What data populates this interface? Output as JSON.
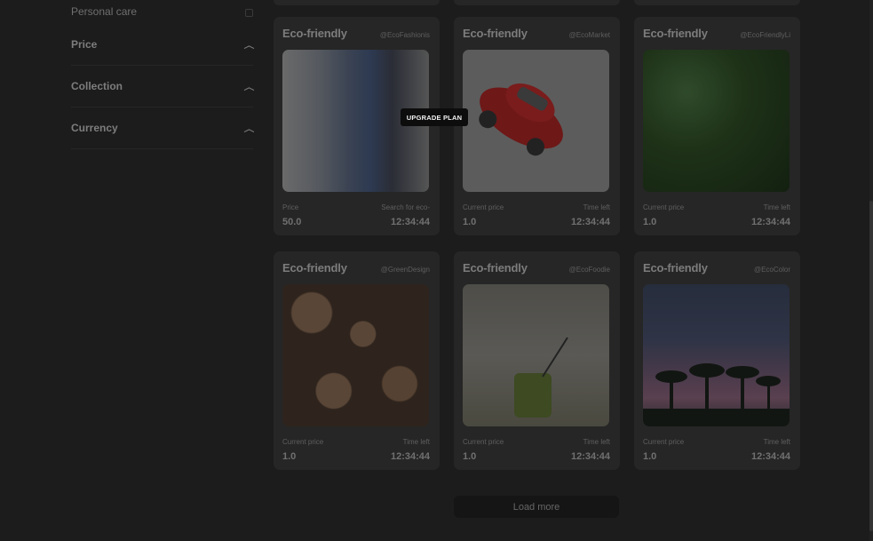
{
  "sidebar": {
    "personal_care": "Personal care",
    "filters": [
      {
        "label": "Price"
      },
      {
        "label": "Collection"
      },
      {
        "label": "Currency"
      }
    ]
  },
  "tooltip": "UPGRADE PLAN",
  "cards": [
    {
      "title": "Eco-friendly",
      "handle": "@EcoFashionis",
      "label_left": "Price",
      "label_right": "Search for eco-",
      "value_left": "50.0",
      "value_right": "12:34:44",
      "image": "stacked-denim-clothes"
    },
    {
      "title": "Eco-friendly",
      "handle": "@EcoMarket",
      "label_left": "Current price",
      "label_right": "Time left",
      "value_left": "1.0",
      "value_right": "12:34:44",
      "image": "red-toy-car"
    },
    {
      "title": "Eco-friendly",
      "handle": "@EcoFriendlyLi",
      "label_left": "Current price",
      "label_right": "Time left",
      "value_left": "1.0",
      "value_right": "12:34:44",
      "image": "mint-leaves"
    },
    {
      "title": "Eco-friendly",
      "handle": "@GreenDesign",
      "label_left": "Current price",
      "label_right": "Time left",
      "value_left": "1.0",
      "value_right": "12:34:44",
      "image": "stacked-logs"
    },
    {
      "title": "Eco-friendly",
      "handle": "@EcoFoodie",
      "label_left": "Current price",
      "label_right": "Time left",
      "value_left": "1.0",
      "value_right": "12:34:44",
      "image": "green-drink"
    },
    {
      "title": "Eco-friendly",
      "handle": "@EcoColor",
      "label_left": "Current price",
      "label_right": "Time left",
      "value_left": "1.0",
      "value_right": "12:34:44",
      "image": "palm-trees-sunset"
    }
  ],
  "load_more": "Load more",
  "icons": {
    "chevron": "chevron-up-icon",
    "checkbox": "checkbox-icon"
  }
}
